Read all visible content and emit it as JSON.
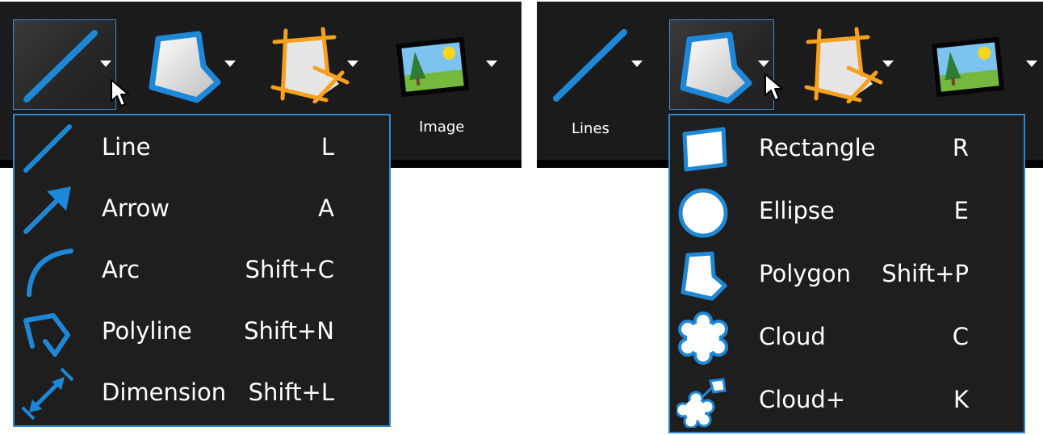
{
  "left": {
    "toolbar": {
      "tools": [
        {
          "icon": "line-tool-icon"
        },
        {
          "icon": "polygon-tool-icon"
        },
        {
          "icon": "crop-tool-icon"
        },
        {
          "icon": "image-tool-icon",
          "label": "Image"
        }
      ]
    },
    "menu": {
      "items": [
        {
          "label": "Line",
          "shortcut": "L",
          "icon": "line-icon"
        },
        {
          "label": "Arrow",
          "shortcut": "A",
          "icon": "arrow-icon"
        },
        {
          "label": "Arc",
          "shortcut": "Shift+C",
          "icon": "arc-icon"
        },
        {
          "label": "Polyline",
          "shortcut": "Shift+N",
          "icon": "polyline-icon"
        },
        {
          "label": "Dimension",
          "shortcut": "Shift+L",
          "icon": "dimension-icon"
        }
      ]
    }
  },
  "right": {
    "toolbar": {
      "tools": [
        {
          "icon": "line-tool-icon",
          "label": "Lines"
        },
        {
          "icon": "polygon-tool-icon"
        },
        {
          "icon": "crop-tool-icon"
        },
        {
          "icon": "image-tool-icon"
        }
      ]
    },
    "menu": {
      "items": [
        {
          "label": "Rectangle",
          "shortcut": "R",
          "icon": "rectangle-icon"
        },
        {
          "label": "Ellipse",
          "shortcut": "E",
          "icon": "ellipse-icon"
        },
        {
          "label": "Polygon",
          "shortcut": "Shift+P",
          "icon": "polygon-icon"
        },
        {
          "label": "Cloud",
          "shortcut": "C",
          "icon": "cloud-icon"
        },
        {
          "label": "Cloud+",
          "shortcut": "K",
          "icon": "cloud-plus-icon"
        }
      ]
    }
  },
  "colors": {
    "accent": "#1e88d8",
    "orange": "#f5a11e",
    "background": "#1b1b1b"
  }
}
